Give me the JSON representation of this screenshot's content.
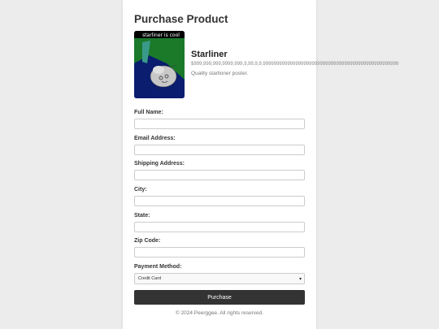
{
  "page": {
    "title": "Purchase Product"
  },
  "product": {
    "image_caption": "starliner is cool",
    "name": "Starliner",
    "price": "$999,999,999,9999,999,9,99,9,9,99999999999999999999999999999999999999999999999999",
    "description": "Quality starlioner poster."
  },
  "form": {
    "full_name_label": "Full Name:",
    "email_label": "Email Address:",
    "shipping_label": "Shipping Address:",
    "city_label": "City:",
    "state_label": "State:",
    "zip_label": "Zip Code:",
    "payment_label": "Payment Method:",
    "payment_selected": "Credit Card",
    "submit_label": "Purchase"
  },
  "footer": {
    "text": "© 2024 Peerggee. All rights reserved."
  },
  "icons": {
    "select_arrow": "chevron-down-icon"
  },
  "colors": {
    "button": "#333333",
    "background": "#ececec",
    "card": "#ffffff"
  }
}
